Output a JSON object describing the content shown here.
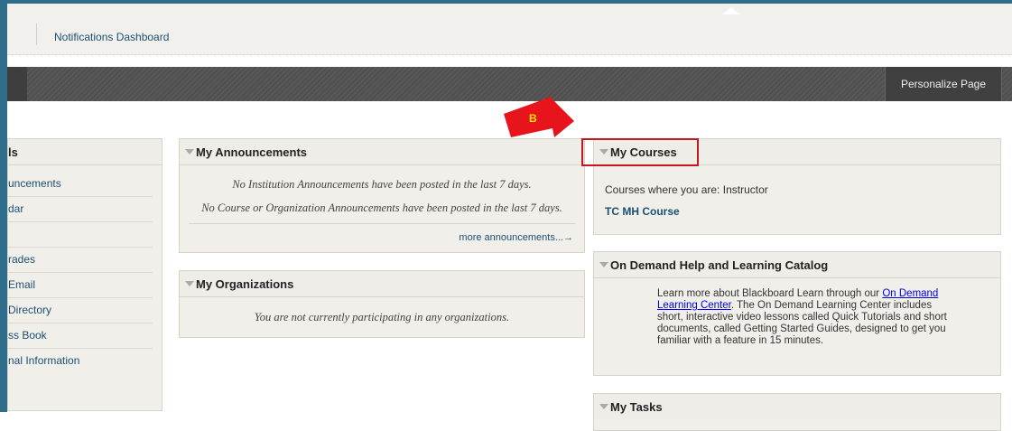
{
  "tabs": {
    "notifications": "Notifications Dashboard"
  },
  "toolbar": {
    "personalize": "Personalize Page"
  },
  "tools": {
    "title": "ls",
    "items": [
      "uncements",
      "dar",
      "",
      "rades",
      "Email",
      "Directory",
      "ss Book",
      "nal Information"
    ]
  },
  "announcements": {
    "title": "My Announcements",
    "line1": "No Institution Announcements have been posted in the last 7 days.",
    "line2": "No Course or Organization Announcements have been posted in the last 7 days.",
    "more": "more announcements...→"
  },
  "organizations": {
    "title": "My Organizations",
    "text": "You are not currently participating in any organizations."
  },
  "courses": {
    "title": "My Courses",
    "where": "Courses where you are: Instructor",
    "course": "TC MH Course"
  },
  "help": {
    "title": "On Demand Help and Learning Catalog",
    "text_before": "Learn more about Blackboard Learn through our ",
    "link": "On Demand Learning Center",
    "text_after": ". The On Demand Learning Center includes short, interactive video lessons called Quick Tutorials and short documents, called Getting Started Guides, designed to get you familiar with a feature in 15 minutes."
  },
  "tasks": {
    "title": "My Tasks"
  },
  "annotation": {
    "label": "B",
    "color": "#e8141b",
    "box_color": "#c8161d"
  }
}
